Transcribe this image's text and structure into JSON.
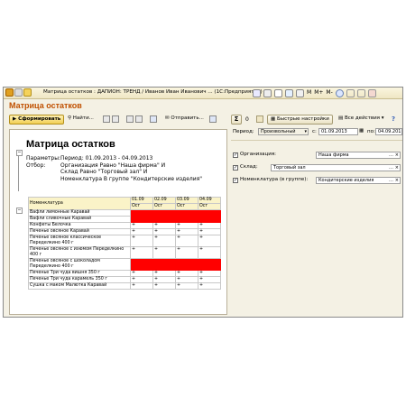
{
  "titlebar": {
    "text": "Матрица остатков : ДАПИОН: ТРЕНД / Иванов Иван Иванович ... (1С:Предприятие)",
    "right_icons": [
      "M",
      "M+",
      "M-"
    ]
  },
  "document": {
    "title": "Матрица остатков"
  },
  "toolbar": {
    "generate": "Сформировать",
    "find": "Найти...",
    "send": "Отправить...",
    "sum_value": "0",
    "quick_settings": "Быстрые настройки",
    "all_actions": "Все действия"
  },
  "report": {
    "title": "Матрица остатков",
    "params_label": "Параметры:",
    "params_value": "Период: 01.09.2013 - 04.09.2013",
    "filter_label": "Отбор:",
    "filter_lines": [
      "Организация Равно \"Наша фирма\" И",
      "Склад Равно \"Торговый зал\" И",
      "Номенклатура В группе \"Кондитерские изделия\""
    ],
    "table": {
      "nom_header": "Номенклатура",
      "dates": [
        "01.09",
        "02.09",
        "03.09",
        "04.09"
      ],
      "sub": "Ост",
      "rows": [
        {
          "name": "Вафли лимонные Каравай",
          "red": true,
          "vals": [
            "",
            "",
            "",
            ""
          ]
        },
        {
          "name": "Вафли сливочные Каравай",
          "red": true,
          "vals": [
            "",
            "",
            "",
            ""
          ]
        },
        {
          "name": "Конфеты Белочка",
          "red": false,
          "vals": [
            "+",
            "+",
            "+",
            "+"
          ]
        },
        {
          "name": "Печенье овсяное Каравай",
          "red": false,
          "vals": [
            "+",
            "+",
            "+",
            "+"
          ]
        },
        {
          "name": "Печенье овсяное классическое Переделкино 400 г",
          "red": false,
          "vals": [
            "+",
            "+",
            "+",
            "+"
          ]
        },
        {
          "name": "Печенье овсяное с изюмом Переделкино 400 г",
          "red": false,
          "vals": [
            "+",
            "+",
            "+",
            "+"
          ]
        },
        {
          "name": "Печенье овсяное с шоколадом Переделкино 400 г",
          "red": true,
          "vals": [
            "",
            "",
            "",
            ""
          ]
        },
        {
          "name": "Печенье Три чуда вишня 350 г",
          "red": false,
          "vals": [
            "+",
            "+",
            "+",
            "+"
          ]
        },
        {
          "name": "Печенье Три чуда карамель 350 г",
          "red": false,
          "vals": [
            "+",
            "+",
            "+",
            "+"
          ]
        },
        {
          "name": "Сушка с маком Малютка Каравай",
          "red": false,
          "vals": [
            "+",
            "+",
            "+",
            "+"
          ]
        }
      ]
    }
  },
  "settings": {
    "period_label": "Период:",
    "period_value": "Произвольный",
    "from_label": "с:",
    "from_value": "01.09.2013",
    "to_label": "по:",
    "to_value": "04.09.201",
    "filters": [
      {
        "label": "Организация:",
        "value": "Наша фирма"
      },
      {
        "label": "Склад:",
        "value": "Торговый зал"
      },
      {
        "label": "Номенклатура (в группе):",
        "value": "Кондитерские изделия"
      }
    ]
  }
}
